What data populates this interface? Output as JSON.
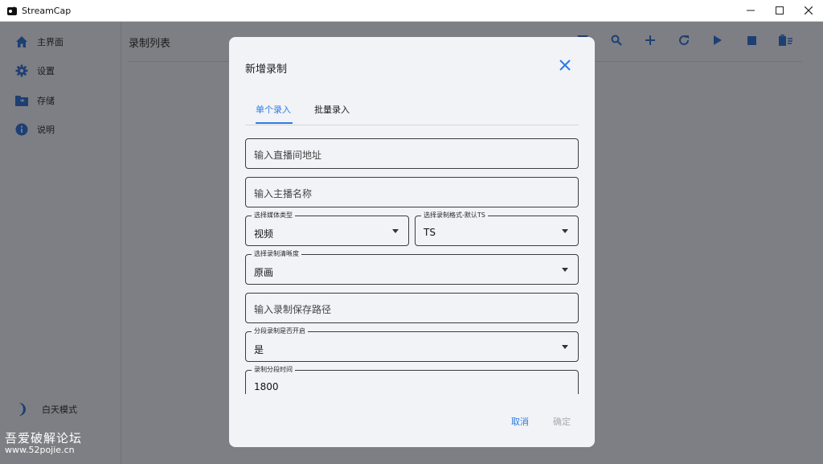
{
  "window": {
    "title": "StreamCap"
  },
  "sidebar": {
    "items": [
      {
        "label": "主界面",
        "icon": "home-icon"
      },
      {
        "label": "设置",
        "icon": "gear-icon"
      },
      {
        "label": "存储",
        "icon": "folder-icon"
      },
      {
        "label": "说明",
        "icon": "info-icon"
      }
    ],
    "theme_label": "白天模式"
  },
  "watermark": {
    "line1": "吾爱破解论坛",
    "line2": "www.52pojie.cn"
  },
  "main": {
    "title": "录制列表",
    "toolbar": [
      "filter-icon",
      "search-icon",
      "add-icon",
      "refresh-icon",
      "play-icon",
      "stop-icon",
      "delete-icon"
    ]
  },
  "dialog": {
    "title": "新增录制",
    "tabs": [
      "单个录入",
      "批量录入"
    ],
    "active_tab": 0,
    "fields": {
      "url_placeholder": "输入直播间地址",
      "streamer_placeholder": "输入主播名称",
      "media_type": {
        "label": "选择媒体类型",
        "value": "视频"
      },
      "record_format": {
        "label": "选择录制格式-默认TS",
        "value": "TS"
      },
      "quality": {
        "label": "选择录制清晰度",
        "value": "原画"
      },
      "save_path_placeholder": "输入录制保存路径",
      "segment_enabled": {
        "label": "分段录制是否开启",
        "value": "是"
      },
      "segment_time": {
        "label": "录制分段时间",
        "value": "1800"
      }
    },
    "cancel_label": "取消",
    "ok_label": "确定"
  },
  "colors": {
    "accent": "#2c7be5",
    "overlay": "#7d7f84",
    "dialog_bg": "#f1f3f7"
  }
}
